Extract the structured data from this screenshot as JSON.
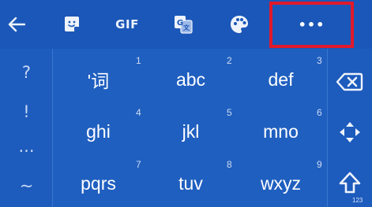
{
  "toolbar": {
    "gif_label": "GIF",
    "more_label": "•••",
    "icons": [
      "back-arrow-icon",
      "sticker-icon",
      "gif-icon",
      "translate-icon",
      "palette-icon",
      "more-icon"
    ]
  },
  "keyboard": {
    "punctuation": [
      "?",
      "!",
      "...",
      "~"
    ],
    "keys": [
      {
        "label": "'词",
        "number": "1"
      },
      {
        "label": "abc",
        "number": "2"
      },
      {
        "label": "def",
        "number": "3"
      },
      {
        "label": "ghi",
        "number": "4"
      },
      {
        "label": "jkl",
        "number": "5"
      },
      {
        "label": "mno",
        "number": "6"
      },
      {
        "label": "pqrs",
        "number": "7"
      },
      {
        "label": "tuv",
        "number": "8"
      },
      {
        "label": "wxyz",
        "number": "9"
      }
    ],
    "shift_label": "123",
    "side_icons": [
      "backspace-icon",
      "cursor-move-icon",
      "shift-icon"
    ]
  },
  "colors": {
    "toolbar_bg": "#1b57b8",
    "keyboard_bg": "#1f5fc0",
    "highlight": "#e01a2b"
  }
}
